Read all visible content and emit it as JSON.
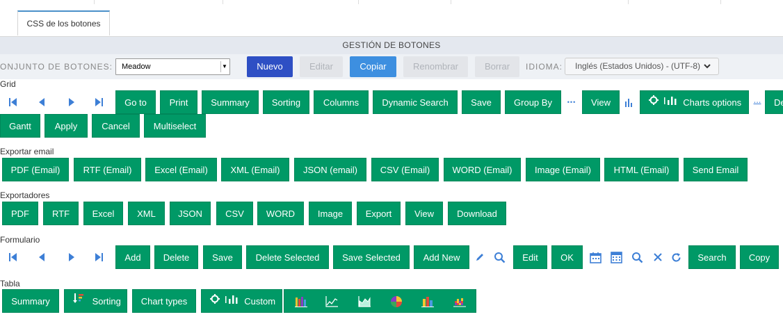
{
  "tab": {
    "label": "CSS de los botones"
  },
  "header": {
    "title": "GESTIÓN DE BOTONES"
  },
  "toolbar": {
    "set_label": "ONJUNTO DE BOTONES:",
    "set_value": "Meadow",
    "new_label": "Nuevo",
    "edit_label": "Editar",
    "copy_label": "Copiar",
    "rename_label": "Renombrar",
    "delete_label": "Borrar",
    "language_label": "IDIOMA:",
    "language_value": "Inglés (Estados Unidos) - (UTF-8)"
  },
  "grid": {
    "label": "Grid",
    "buttons": [
      "Go to",
      "Print",
      "Summary",
      "Sorting",
      "Columns",
      "Dynamic Search",
      "Save",
      "Group By",
      "View",
      "Charts options",
      "De",
      "Gantt",
      "Apply",
      "Cancel",
      "Multiselect"
    ],
    "ellipsis": "...",
    "more": "•••"
  },
  "export_email": {
    "label": "Exportar email",
    "buttons": [
      "PDF (Email)",
      "RTF (Email)",
      "Excel (Email)",
      "XML (Email)",
      "JSON (email)",
      "CSV (Email)",
      "WORD (Email)",
      "Image (Email)",
      "HTML (Email)",
      "Send Email"
    ]
  },
  "exporters": {
    "label": "Exportadores",
    "buttons": [
      "PDF",
      "RTF",
      "Excel",
      "XML",
      "JSON",
      "CSV",
      "WORD",
      "Image",
      "Export",
      "View",
      "Download"
    ]
  },
  "form": {
    "label": "Formulario",
    "buttons": [
      "Add",
      "Delete",
      "Save",
      "Delete Selected",
      "Save Selected",
      "Add New",
      "Edit",
      "OK",
      "Search",
      "Copy"
    ]
  },
  "table": {
    "label": "Tabla",
    "buttons": [
      "Summary",
      "Sorting",
      "Chart types",
      "Custom"
    ]
  },
  "colors": {
    "green": "#009966",
    "primary": "#2e4fc4",
    "blue": "#3d8fe0",
    "nav_icon": "#3d7fd6"
  }
}
